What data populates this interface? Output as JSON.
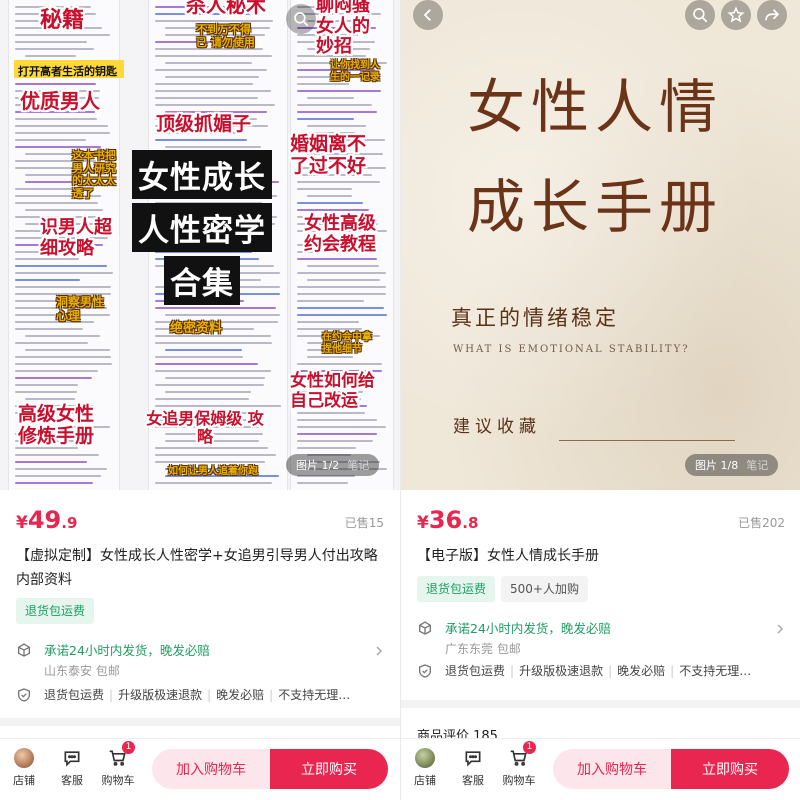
{
  "left": {
    "hero": {
      "stickers": {
        "miji": "秘籍",
        "shaRen": "杀人秘术",
        "shengLiao": "聊闷骚女人的妙招",
        "buDaoWanBuDe": "不到万不得已 请勿使用",
        "qingXu": "让你找到人生的一记录",
        "keyLine": "打开高者生活的钥匙",
        "youzhi": "优质男人",
        "dingji": "顶级抓媚子",
        "zhegeShu": "这本书把 男人研究 的太太太 透了",
        "hunyin": "婚姻离不 了过不好",
        "shiNanRen": "识男人超 细攻略",
        "nvxingGaoji": "女性高级 约会教程",
        "dongCha": "洞察男性 心理",
        "juemi": "绝密资料",
        "zaiYueHui": "在约会中拿 捏他细节",
        "gaojiNvXing": "高级女性 修炼手册",
        "nvZhui": "女追男保姆级 攻略",
        "nvxingRuhe": "女性如何给 自己改运",
        "zhuiNan": "如何让男人追着你跑"
      },
      "main_title_lines": [
        "女性成长",
        "人性密学",
        "合集"
      ],
      "counter": "图片 1/2",
      "counter_note": "笔记"
    },
    "price": {
      "currency": "¥",
      "integer": "49",
      "decimal": ".9"
    },
    "sold": "已售15",
    "title": "【虚拟定制】女性成长人性密学+女追男引导男人付出攻略 内部资料",
    "tags": [
      "退货包运费"
    ],
    "promise": {
      "text": "承诺24小时内发货，晚发必赔",
      "location": "山东泰安 包邮"
    },
    "services": [
      "退货包运费",
      "升级版极速退款",
      "晚发必赔",
      "不支持无理…"
    ],
    "bottom": {
      "shop": "店铺",
      "service": "客服",
      "cart": "购物车",
      "cart_badge": "1",
      "add_cart": "加入购物车",
      "buy_now": "立即购买"
    }
  },
  "right": {
    "hero": {
      "title_line1": "女性人情",
      "title_line2": "成长手册",
      "subtitle": "真正的情绪稳定",
      "subtitle_en": "WHAT IS EMOTIONAL STABILITY?",
      "save_text": "建议收藏",
      "counter": "图片 1/8",
      "counter_note": "笔记"
    },
    "price": {
      "currency": "¥",
      "integer": "36",
      "decimal": ".8"
    },
    "sold": "已售202",
    "title": "【电子版】女性人情成长手册",
    "tags": [
      "退货包运费",
      "500+人加购"
    ],
    "promise": {
      "text": "承诺24小时内发货，晚发必赔",
      "location": "广东东莞 包邮"
    },
    "services": [
      "退货包运费",
      "升级版极速退款",
      "晚发必赔",
      "不支持无理…"
    ],
    "reviews": "商品评价 185",
    "bottom": {
      "shop": "店铺",
      "service": "客服",
      "cart": "购物车",
      "cart_badge": "1",
      "add_cart": "加入购物车",
      "buy_now": "立即购买"
    }
  },
  "colors": {
    "accent": "#e8264f",
    "green": "#1f9d60",
    "poster_brown": "#6b3419"
  },
  "icons": [
    "back-icon",
    "search-icon",
    "star-icon",
    "share-icon",
    "location-icon",
    "shield-icon",
    "chat-icon",
    "cart-icon",
    "chevron-right-icon"
  ]
}
